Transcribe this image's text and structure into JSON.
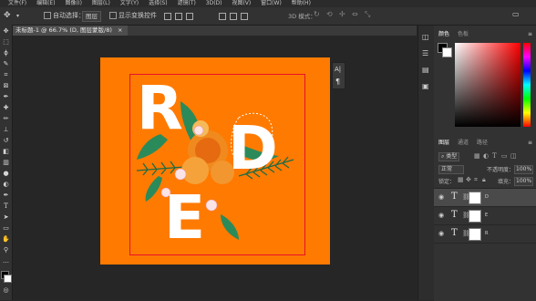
{
  "menu": [
    "文件(F)",
    "编辑(E)",
    "图像(I)",
    "图层(L)",
    "文字(Y)",
    "选择(S)",
    "滤镜(T)",
    "3D(D)",
    "视图(V)",
    "窗口(W)",
    "帮助(H)"
  ],
  "options": {
    "auto_select": "自动选择：",
    "auto_select_target": "图层",
    "show_transform": "显示变换控件",
    "mode_3d": "3D 模式："
  },
  "document_tab": {
    "title": "未标题-1 @ 66.7% (D, 图层蒙版/8)",
    "close": "×"
  },
  "artwork": {
    "letters": [
      "R",
      "D",
      "E"
    ],
    "bg_color": "#ff7a00",
    "frame_color": "#e8102a"
  },
  "color_panel": {
    "tabs": [
      "颜色",
      "色板"
    ]
  },
  "layers_panel": {
    "tabs": [
      "图层",
      "通道",
      "路径"
    ],
    "filter_kind": "类型",
    "blend_mode": "正常",
    "opacity_label": "不透明度：",
    "opacity": "100%",
    "lock_label": "锁定：",
    "fill_label": "填充：",
    "fill": "100%",
    "layers": [
      {
        "name": "D"
      },
      {
        "name": "E"
      },
      {
        "name": "R"
      }
    ]
  }
}
